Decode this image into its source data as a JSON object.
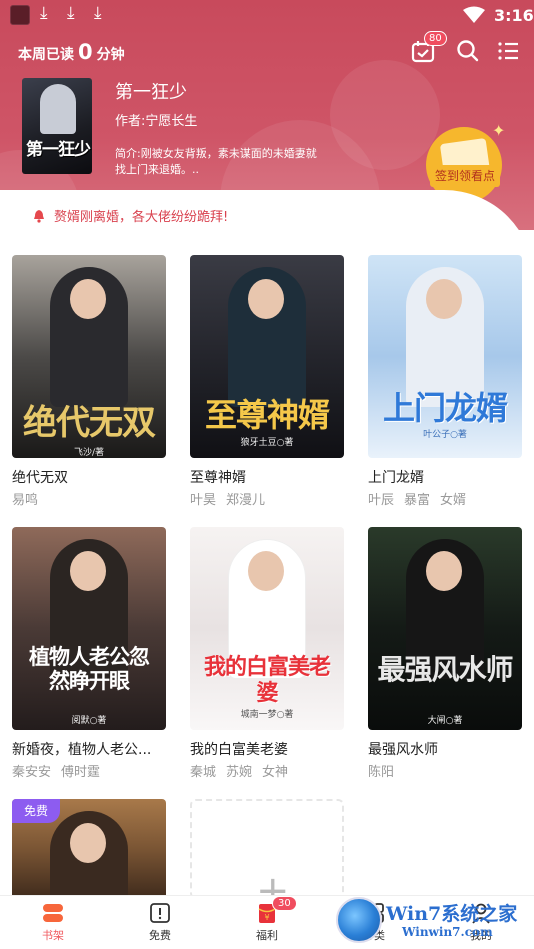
{
  "status_bar": {
    "time": "3:16"
  },
  "header": {
    "reading_prefix": "本周已读",
    "reading_minutes": "0",
    "reading_suffix": "分钟",
    "checkin_badge": "80"
  },
  "featured": {
    "cover_text": "第一狂少",
    "title": "第一狂少",
    "author": "作者:宁愿长生",
    "intro": "简介:刚被女友背叛，素未谋面的未婚妻就找上门来退婚。.."
  },
  "signin": {
    "label": "签到领看点"
  },
  "notice": {
    "text": "赘婿刚离婚，各大佬纷纷跪拜!"
  },
  "books": [
    {
      "cover_title": "绝代无双",
      "cover_author": "飞沙/著",
      "title": "绝代无双",
      "tags": [
        "易鸣"
      ],
      "colors": [
        "#a8a39c",
        "#4c4a48",
        "#1a1918"
      ],
      "accent": "#e7c86a"
    },
    {
      "cover_title": "至尊神婿",
      "cover_author": "狼牙土豆○著",
      "title": "至尊神婿",
      "tags": [
        "叶昊",
        "郑漫儿"
      ],
      "colors": [
        "#3a3b44",
        "#24252c",
        "#101014"
      ],
      "accent": "#f5c84a"
    },
    {
      "cover_title": "上门龙婿",
      "cover_author": "叶公子○著",
      "title": "上门龙婿",
      "tags": [
        "叶辰",
        "暴富",
        "女婿"
      ],
      "colors": [
        "#cfe4f6",
        "#a7c8ea",
        "#e9f2fb"
      ],
      "accent": "#2f79d8"
    },
    {
      "cover_title": "植物人老公忽然睁开眼",
      "cover_author": "阅默○著",
      "title": "新婚夜，植物人老公...",
      "tags": [
        "秦安安",
        "傅时霆"
      ],
      "colors": [
        "#8f6a5a",
        "#4a3a36",
        "#231c1c"
      ],
      "accent": "#ffffff"
    },
    {
      "cover_title": "我的白富美老婆",
      "cover_author": "城南一梦○著",
      "title": "我的白富美老婆",
      "tags": [
        "秦城",
        "苏婉",
        "女神"
      ],
      "colors": [
        "#f6f3f2",
        "#e8e2e2",
        "#f9f7f7"
      ],
      "accent": "#e8323a"
    },
    {
      "cover_title": "最强风水师",
      "cover_author": "大闸○著",
      "title": "最强风水师",
      "tags": [
        "陈阳"
      ],
      "colors": [
        "#2a3a2a",
        "#141a16",
        "#0a0c0b"
      ],
      "accent": "#e8e8e8"
    },
    {
      "free_label": "免费",
      "colors": [
        "#a8794a",
        "#7a5534",
        "#3e2a1c"
      ]
    }
  ],
  "tabs": [
    {
      "label": "书架"
    },
    {
      "label": "免费"
    },
    {
      "label": "福利",
      "badge": "30"
    },
    {
      "label": "分类"
    },
    {
      "label": "我的"
    }
  ],
  "watermark": {
    "main": "Win7系统之家",
    "sub": "Winwin7.com"
  }
}
